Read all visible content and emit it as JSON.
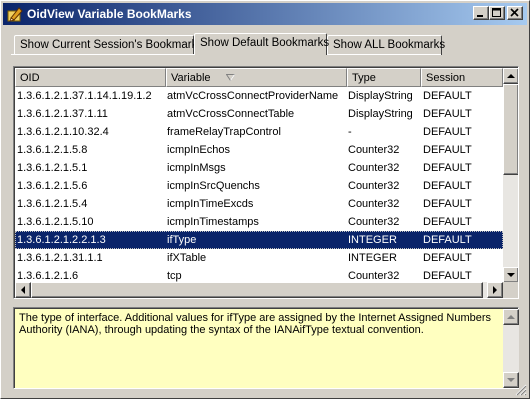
{
  "window": {
    "title": "OidView Variable BookMarks"
  },
  "tabs": [
    {
      "label": "Show Current Session's Bookmarks"
    },
    {
      "label": "Show Default Bookmarks"
    },
    {
      "label": "Show ALL Bookmarks"
    }
  ],
  "active_tab": 1,
  "table": {
    "columns": [
      "OID",
      "Variable",
      "Type",
      "Session"
    ],
    "sort_column": "Variable",
    "rows": [
      {
        "oid": "1.3.6.1.2.1.37.1.14.1.19.1.2",
        "variable": "atmVcCrossConnectProviderName",
        "type": "DisplayString",
        "session": "DEFAULT"
      },
      {
        "oid": "1.3.6.1.2.1.37.1.11",
        "variable": "atmVcCrossConnectTable",
        "type": "DisplayString",
        "session": "DEFAULT"
      },
      {
        "oid": "1.3.6.1.2.1.10.32.4",
        "variable": "frameRelayTrapControl",
        "type": "-",
        "session": "DEFAULT"
      },
      {
        "oid": "1.3.6.1.2.1.5.8",
        "variable": "icmpInEchos",
        "type": "Counter32",
        "session": "DEFAULT"
      },
      {
        "oid": "1.3.6.1.2.1.5.1",
        "variable": "icmpInMsgs",
        "type": "Counter32",
        "session": "DEFAULT"
      },
      {
        "oid": "1.3.6.1.2.1.5.6",
        "variable": "icmpInSrcQuenchs",
        "type": "Counter32",
        "session": "DEFAULT"
      },
      {
        "oid": "1.3.6.1.2.1.5.4",
        "variable": "icmpInTimeExcds",
        "type": "Counter32",
        "session": "DEFAULT"
      },
      {
        "oid": "1.3.6.1.2.1.5.10",
        "variable": "icmpInTimestamps",
        "type": "Counter32",
        "session": "DEFAULT"
      },
      {
        "oid": "1.3.6.1.2.1.2.2.1.3",
        "variable": "ifType",
        "type": "INTEGER",
        "session": "DEFAULT",
        "selected": true
      },
      {
        "oid": "1.3.6.1.2.1.31.1.1",
        "variable": "ifXTable",
        "type": "INTEGER",
        "session": "DEFAULT"
      },
      {
        "oid": "1.3.6.1.2.1.6",
        "variable": "tcp",
        "type": "Counter32",
        "session": "DEFAULT"
      }
    ]
  },
  "description": {
    "text": "The type of interface. Additional values for ifType are assigned by the Internet Assigned Numbers Authority (IANA), through updating the syntax of the IANAifType textual convention."
  },
  "icons": {
    "app": "pencil-bookmark-icon",
    "minimize": "minimize-icon",
    "maximize": "maximize-icon",
    "close": "close-icon",
    "sort": "sort-descending-icon"
  },
  "colors": {
    "title_start": "#0a246a",
    "title_end": "#a6caf0",
    "selection": "#0a246a",
    "description_bg": "#ffffc0"
  }
}
